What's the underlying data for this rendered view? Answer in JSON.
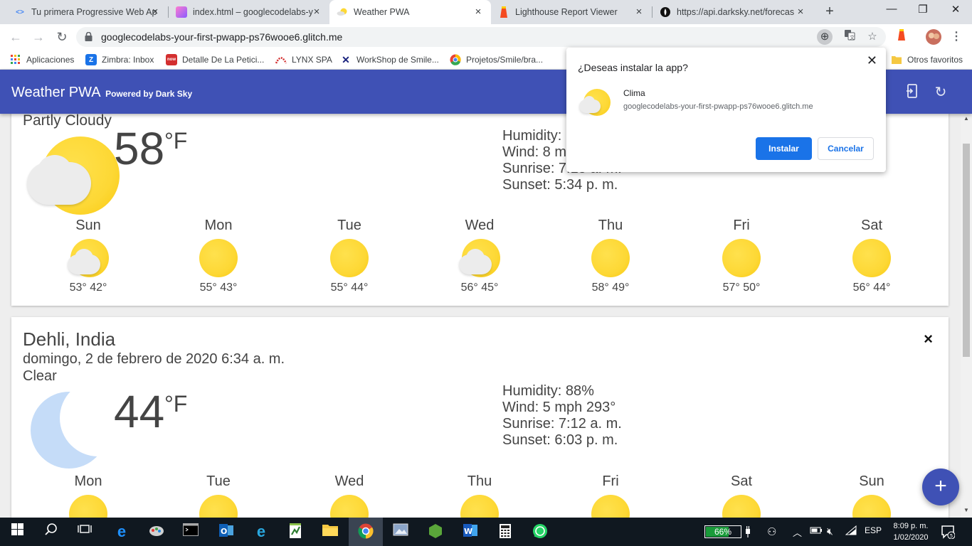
{
  "browser": {
    "tabs": [
      {
        "title": "Tu primera Progressive Web Ap",
        "active": false
      },
      {
        "title": "index.html – googlecodelabs-y",
        "active": false
      },
      {
        "title": "Weather PWA",
        "active": true
      },
      {
        "title": "Lighthouse Report Viewer",
        "active": false
      },
      {
        "title": "https://api.darksky.net/forecas",
        "active": false
      }
    ],
    "url": "googlecodelabs-your-first-pwapp-ps76wooe6.glitch.me",
    "bookmarks": [
      {
        "label": "Aplicaciones"
      },
      {
        "label": "Zimbra: Inbox"
      },
      {
        "label": "Detalle De La Petici..."
      },
      {
        "label": "LYNX SPA"
      },
      {
        "label": "WorkShop de Smile..."
      },
      {
        "label": "Projetos/Smile/bra..."
      },
      {
        "label": "Otros favoritos"
      }
    ]
  },
  "app": {
    "title": "Weather PWA",
    "subtitle": "Powered by Dark Sky"
  },
  "cards": [
    {
      "description": "Partly Cloudy",
      "temperature": "58",
      "unit": "°F",
      "humidity": "Humidity:",
      "wind": "Wind: 8 m",
      "sunrise": "Sunrise: 7:15 a. m.",
      "sunset": "Sunset: 5:34 p. m.",
      "forecast": [
        {
          "day": "Sun",
          "temps": "53° 42°",
          "icon": "partly-cloudy-icon"
        },
        {
          "day": "Mon",
          "temps": "55° 43°",
          "icon": "sun-icon"
        },
        {
          "day": "Tue",
          "temps": "55° 44°",
          "icon": "sun-icon"
        },
        {
          "day": "Wed",
          "temps": "56° 45°",
          "icon": "partly-cloudy-icon"
        },
        {
          "day": "Thu",
          "temps": "58° 49°",
          "icon": "sun-icon"
        },
        {
          "day": "Fri",
          "temps": "57° 50°",
          "icon": "sun-icon"
        },
        {
          "day": "Sat",
          "temps": "56° 44°",
          "icon": "sun-icon"
        }
      ]
    },
    {
      "location": "Dehli, India",
      "date": "domingo, 2 de febrero de 2020 6:34 a. m.",
      "description": "Clear",
      "temperature": "44",
      "unit": "°F",
      "humidity": "Humidity: 88%",
      "wind": "Wind: 5 mph 293°",
      "sunrise": "Sunrise: 7:12 a. m.",
      "sunset": "Sunset: 6:03 p. m.",
      "close": "×",
      "forecast": [
        {
          "day": "Mon"
        },
        {
          "day": "Tue"
        },
        {
          "day": "Wed"
        },
        {
          "day": "Thu"
        },
        {
          "day": "Fri"
        },
        {
          "day": "Sat"
        },
        {
          "day": "Sun"
        }
      ]
    }
  ],
  "fab": "+",
  "install_dialog": {
    "title": "¿Deseas instalar la app?",
    "app_name": "Clima",
    "origin": "googlecodelabs-your-first-pwapp-ps76wooe6.glitch.me",
    "install_label": "Instalar",
    "cancel_label": "Cancelar"
  },
  "taskbar": {
    "battery": "66%",
    "battery_level": 0.66,
    "language": "ESP",
    "time": "8:09 p. m.",
    "date": "1/02/2020",
    "notifications": "5"
  },
  "colors": {
    "header": "#3f51b5",
    "sun": "#fdd835",
    "moon": "#c5dcf8",
    "install_button": "#1a73e8"
  }
}
